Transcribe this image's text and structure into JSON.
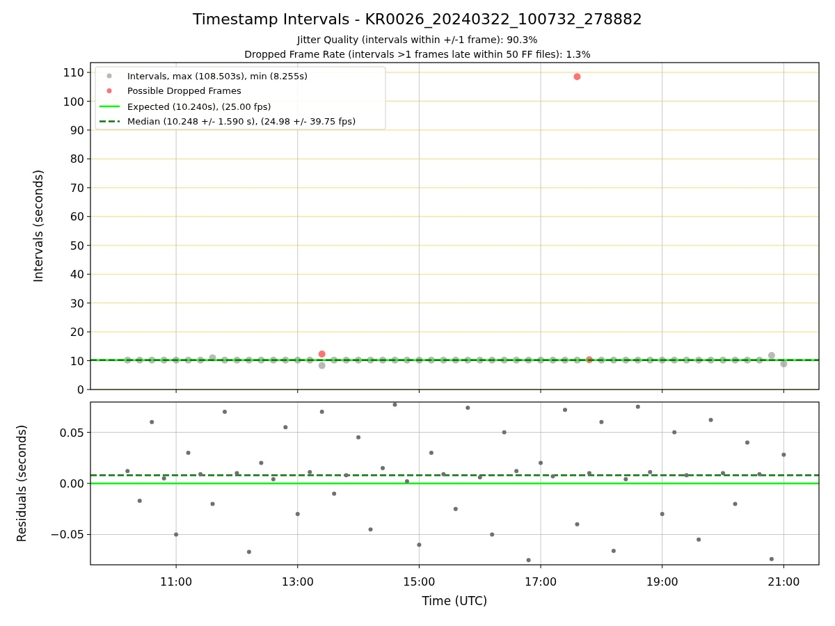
{
  "figure": {
    "title": "Timestamp Intervals - KR0026_20240322_100732_278882",
    "subtitle_lines": [
      "Jitter Quality (intervals within +/-1 frame): 90.3%",
      "Dropped Frame Rate (intervals >1 frames late within 50 FF files): 1.3%"
    ]
  },
  "charts": [
    {
      "chart_data": {
        "type": "scatter",
        "ylabel": "Intervals (seconds)",
        "xlim": [
          9.59,
          21.58
        ],
        "ylim": [
          0,
          113.4
        ],
        "yticks": [
          0,
          10,
          20,
          30,
          40,
          50,
          60,
          70,
          80,
          90,
          100,
          110
        ],
        "x": [
          10.2,
          10.4,
          10.6,
          10.8,
          11.0,
          11.2,
          11.4,
          11.6,
          11.8,
          12.0,
          12.2,
          12.4,
          12.6,
          12.8,
          13.0,
          13.2,
          13.4,
          13.6,
          13.8,
          14.0,
          14.2,
          14.4,
          14.6,
          14.8,
          15.0,
          15.2,
          15.4,
          15.6,
          15.8,
          16.0,
          16.2,
          16.4,
          16.6,
          16.8,
          17.0,
          17.2,
          17.4,
          17.6,
          17.8,
          18.0,
          18.2,
          18.4,
          18.6,
          18.8,
          19.0,
          19.2,
          19.4,
          19.6,
          19.8,
          20.0,
          20.2,
          20.4,
          20.6,
          20.8,
          21.0
        ],
        "series": [
          {
            "name": "Intervals, max (108.503s), min (8.255s)",
            "color": "#808080",
            "values": [
              10.2,
              10.2,
              10.2,
              10.2,
              10.2,
              10.2,
              10.2,
              11.0,
              10.2,
              10.2,
              10.2,
              10.2,
              10.2,
              10.2,
              10.2,
              10.2,
              8.3,
              10.2,
              10.2,
              10.2,
              10.2,
              10.2,
              10.2,
              10.2,
              10.2,
              10.2,
              10.2,
              10.2,
              10.2,
              10.2,
              10.2,
              10.2,
              10.2,
              10.2,
              10.2,
              10.2,
              10.2,
              10.2,
              null,
              10.2,
              10.2,
              10.2,
              10.2,
              10.2,
              10.2,
              10.2,
              10.2,
              10.2,
              10.2,
              10.2,
              10.2,
              10.2,
              10.2,
              11.8,
              8.9
            ]
          },
          {
            "name": "Possible Dropped Frames",
            "color": "#ff0000",
            "values": [
              null,
              null,
              null,
              null,
              null,
              null,
              null,
              null,
              null,
              null,
              null,
              null,
              null,
              null,
              null,
              null,
              12.3,
              null,
              null,
              null,
              null,
              null,
              null,
              null,
              null,
              null,
              null,
              null,
              null,
              null,
              null,
              null,
              null,
              null,
              null,
              null,
              null,
              108.5,
              10.3,
              null,
              null,
              null,
              null,
              null,
              null,
              null,
              null,
              null,
              null,
              null,
              null,
              null,
              null,
              null,
              null
            ]
          }
        ],
        "ref_lines": [
          {
            "axis": "y",
            "value": 10.2,
            "label": "Expected (10.240s), (25.00 fps)",
            "color": "#00ff00"
          },
          {
            "axis": "y",
            "value": 10.2,
            "label": "Median (10.248 +/- 1.590 s), (24.98 +/- 39.75 fps)",
            "color": "#008000"
          }
        ],
        "grid": true,
        "legend": true
      }
    },
    {
      "chart_data": {
        "type": "scatter",
        "xlabel": "Time (UTC)",
        "ylabel": "Residuals (seconds)",
        "xlim": [
          9.59,
          21.58
        ],
        "ylim": [
          -0.0796,
          0.0796
        ],
        "xticks": [
          {
            "value": 11,
            "label": "11:00"
          },
          {
            "value": 13,
            "label": "13:00"
          },
          {
            "value": 15,
            "label": "15:00"
          },
          {
            "value": 17,
            "label": "17:00"
          },
          {
            "value": 19,
            "label": "19:00"
          },
          {
            "value": 21,
            "label": "21:00"
          }
        ],
        "yticks": [
          {
            "value": -0.05,
            "label": "−0.05"
          },
          {
            "value": 0,
            "label": "0.00"
          },
          {
            "value": 0.05,
            "label": "0.05"
          }
        ],
        "x": [
          10.2,
          10.4,
          10.6,
          10.8,
          11.0,
          11.2,
          11.4,
          11.6,
          11.8,
          12.0,
          12.2,
          12.4,
          12.6,
          12.8,
          13.0,
          13.2,
          13.4,
          13.6,
          13.8,
          14.0,
          14.2,
          14.4,
          14.6,
          14.8,
          15.0,
          15.2,
          15.4,
          15.6,
          15.8,
          16.0,
          16.2,
          16.4,
          16.6,
          16.8,
          17.0,
          17.2,
          17.4,
          17.6,
          17.8,
          18.0,
          18.2,
          18.4,
          18.6,
          18.8,
          19.0,
          19.2,
          19.4,
          19.6,
          19.8,
          20.0,
          20.2,
          20.4,
          20.6,
          20.8,
          21.0
        ],
        "series": [
          {
            "color": "#707070",
            "values": [
              0.012,
              -0.017,
              0.06,
              0.005,
              -0.05,
              0.03,
              0.009,
              -0.02,
              0.07,
              0.01,
              -0.067,
              0.02,
              0.004,
              0.055,
              -0.03,
              0.011,
              0.07,
              -0.01,
              0.008,
              0.045,
              -0.045,
              0.015,
              0.077,
              0.002,
              -0.06,
              0.03,
              0.009,
              -0.025,
              0.074,
              0.006,
              -0.05,
              0.05,
              0.012,
              -0.075,
              0.02,
              0.007,
              0.072,
              -0.04,
              0.01,
              0.06,
              -0.066,
              0.004,
              0.075,
              0.011,
              -0.03,
              0.05,
              0.008,
              -0.055,
              0.062,
              0.01,
              -0.02,
              0.04,
              0.009,
              -0.074,
              0.028
            ]
          }
        ],
        "ref_lines": [
          {
            "axis": "y",
            "value": 0,
            "color": "#00ff00"
          },
          {
            "axis": "y",
            "value": 0.008,
            "color": "#008000"
          }
        ],
        "grid": true
      }
    }
  ]
}
